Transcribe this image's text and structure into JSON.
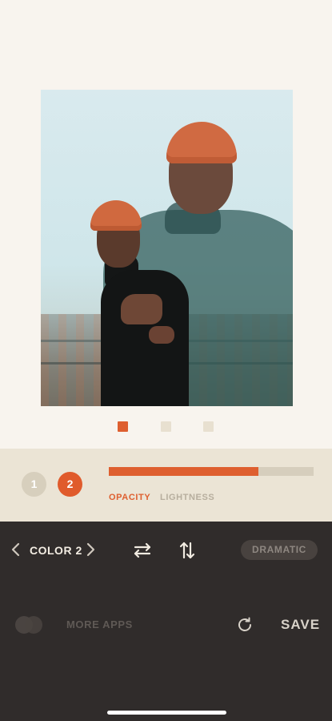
{
  "colors": {
    "accent": "#de5f2f",
    "panel": "#ebe4d5",
    "dark": "#302c2b"
  },
  "photo": {
    "description_icon": "photo-preview"
  },
  "pager": {
    "count": 3,
    "active": 0
  },
  "adjust": {
    "chip_1": "1",
    "chip_2": "2",
    "active_chip": "2",
    "slider_value": 0.73,
    "tab_opacity": "OPACITY",
    "tab_lightness": "LIGHTNESS",
    "active_tab": "OPACITY"
  },
  "toolbar": {
    "color_label": "COLOR 2",
    "prev_icon": "chevron-left-icon",
    "next_icon": "chevron-right-icon",
    "swap_h_icon": "swap-horizontal-icon",
    "swap_v_icon": "swap-vertical-icon",
    "preset": "DRAMATIC"
  },
  "footer": {
    "more_apps": "MORE APPS",
    "save": "SAVE",
    "reset_icon": "reset-icon",
    "more_apps_icon": "more-apps-icon"
  }
}
